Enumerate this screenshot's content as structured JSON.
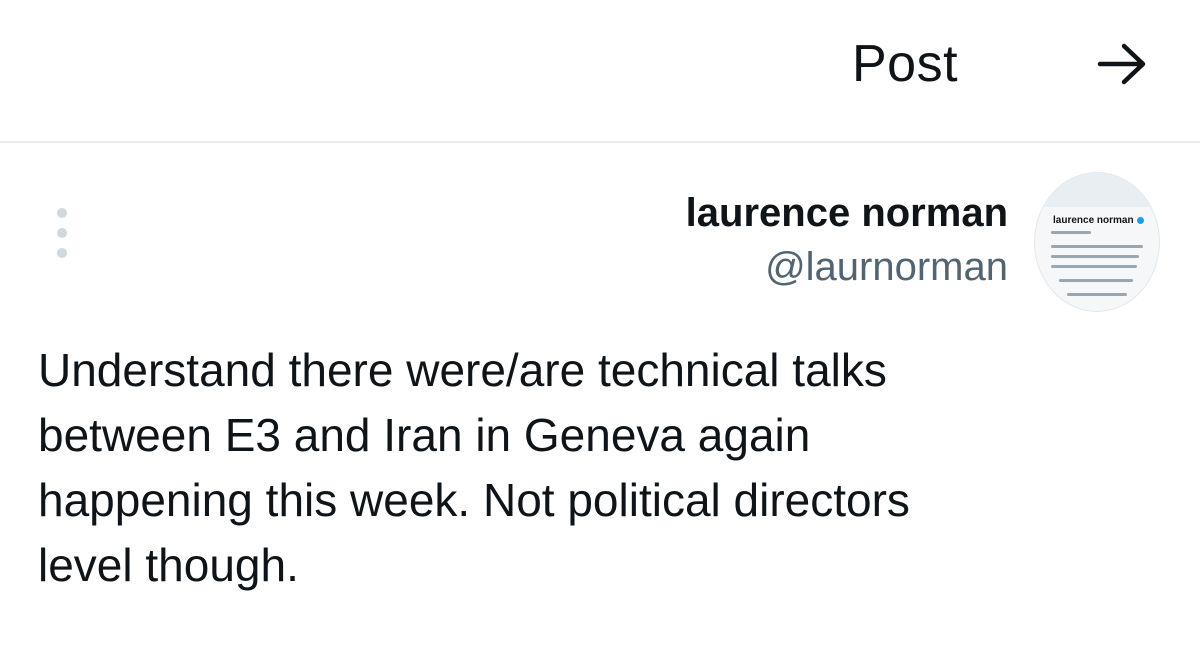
{
  "header": {
    "title": "Post",
    "back_icon": "arrow-right-icon"
  },
  "post": {
    "more_icon": "more-vertical-icon",
    "author": {
      "name": "laurence norman",
      "handle": "@laurnorman",
      "avatar_icon": "profile-card-thumbnail",
      "avatar_name": "laurence norman",
      "verified_color": "#1d9bf0"
    },
    "text_lines": [
      "Understand there were/are technical talks",
      "between E3 and Iran in Geneva again",
      "happening this week. Not political directors",
      "level though."
    ]
  },
  "colors": {
    "text_primary": "#0f1419",
    "text_secondary": "#536471",
    "divider": "#e6ecf0",
    "accent": "#1d9bf0"
  }
}
